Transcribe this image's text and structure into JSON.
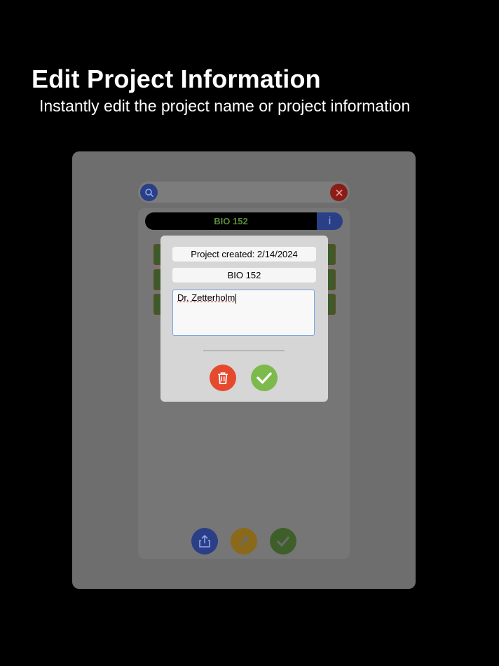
{
  "promo": {
    "headline": "Edit Project Information",
    "subheadline": "Instantly edit the project name or project information"
  },
  "app": {
    "project_title": "BIO 152",
    "info_label": "i",
    "dialog": {
      "created": "Project created: 2/14/2024",
      "name_value": "BIO 152",
      "notes_value": "Dr. Zetterholm"
    },
    "colors": {
      "search": "#2a3f86",
      "close": "#8a1d17",
      "share": "#2a3f86",
      "mic": "#8a6a1a",
      "done": "#3f5f2a",
      "delete": "#e64a2e",
      "confirm": "#7cba4b"
    }
  }
}
